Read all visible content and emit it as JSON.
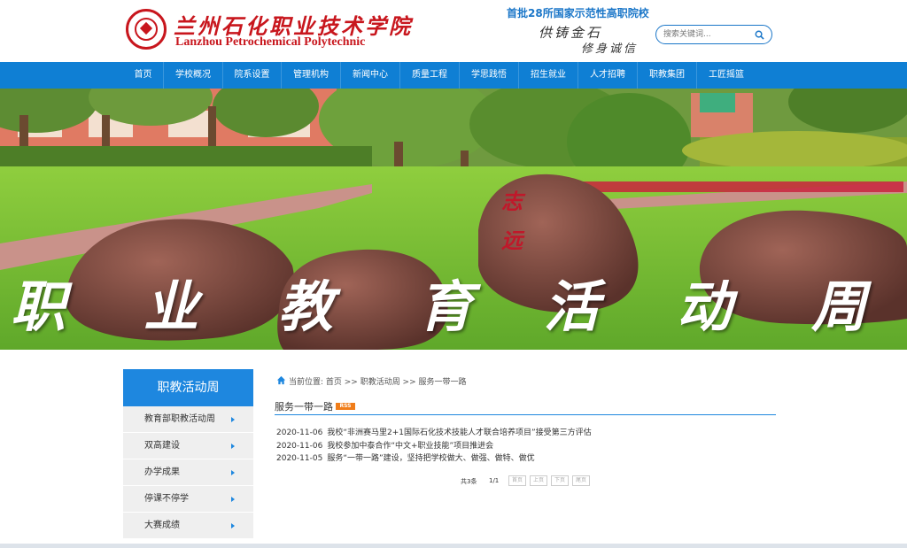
{
  "header": {
    "logo_cn": "兰州石化职业技术学院",
    "logo_en": "Lanzhou Petrochemical Polytechnic",
    "tagline": "首批28所国家示范性高职院校",
    "motto_line1": "供铸金石",
    "motto_line2": "修身诚信",
    "search": {
      "placeholder": "搜索关键词..."
    }
  },
  "nav": {
    "items": [
      {
        "label": "首页"
      },
      {
        "label": "学校概况"
      },
      {
        "label": "院系设置"
      },
      {
        "label": "管理机构"
      },
      {
        "label": "新闻中心"
      },
      {
        "label": "质量工程"
      },
      {
        "label": "学思践悟"
      },
      {
        "label": "招生就业"
      },
      {
        "label": "人才招聘"
      },
      {
        "label": "职教集团"
      },
      {
        "label": "工匠摇篮"
      }
    ]
  },
  "banner": {
    "chars": [
      "职",
      "业",
      "教",
      "育",
      "活",
      "动",
      "周"
    ],
    "rock_inscription": "志远"
  },
  "sidebar": {
    "title": "职教活动周",
    "items": [
      {
        "label": "教育部职教活动周"
      },
      {
        "label": "双高建设"
      },
      {
        "label": "办学成果"
      },
      {
        "label": "停课不停学"
      },
      {
        "label": "大赛成绩"
      }
    ]
  },
  "main": {
    "breadcrumb": "当前位置: 首页 >> 职教活动周 >> 服务一带一路",
    "section_title": "服务一带一路",
    "rss_label": "RSS",
    "news": [
      {
        "date": "2020-11-06",
        "title": "我校“非洲赛马里2+1国际石化技术技能人才联合培养项目”接受第三方评估"
      },
      {
        "date": "2020-11-06",
        "title": "我校参加中泰合作“中文+职业技能”项目推进会"
      },
      {
        "date": "2020-11-05",
        "title": "服务“一带一路”建设，坚持把学校做大、做强、做特、做优"
      }
    ],
    "pager": {
      "total": "共3条",
      "pages": "1/1",
      "buttons": [
        "首页",
        "上页",
        "下页",
        "尾页"
      ]
    }
  },
  "colors": {
    "brand_red": "#c8161d",
    "nav_blue": "#0f7fd4",
    "accent_blue": "#1e87df",
    "rss_orange": "#f07d19"
  }
}
